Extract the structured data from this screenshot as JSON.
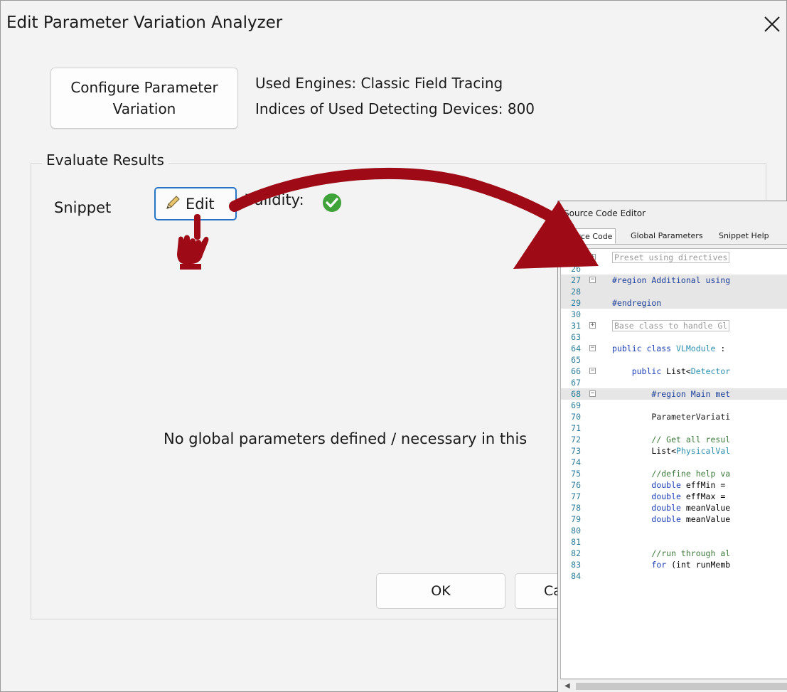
{
  "dialog": {
    "title": "Edit Parameter Variation Analyzer",
    "configure_button": "Configure Parameter Variation",
    "used_engines": "Used Engines: Classic Field Tracing",
    "detecting_devices": "Indices of Used Detecting Devices: 800",
    "group_title": "Evaluate Results",
    "snippet_label": "Snippet",
    "edit_button": "Edit",
    "validity_label": "Validity:",
    "no_params_message": "No global parameters defined / necessary in this",
    "ok_button": "OK",
    "cancel_button": "Ca"
  },
  "editor": {
    "title": "Source Code Editor",
    "tabs": [
      "Source Code",
      "Global Parameters",
      "Snippet Help"
    ],
    "lines": [
      {
        "n": "1",
        "text": "Preset using directives",
        "style": "collapsed",
        "fold": "plus"
      },
      {
        "n": "26",
        "text": ""
      },
      {
        "n": "27",
        "text": "#region Additional using",
        "style": "region",
        "fold": "minus",
        "shade": true
      },
      {
        "n": "28",
        "text": "",
        "shade": true
      },
      {
        "n": "29",
        "text": "#endregion",
        "style": "region",
        "shade": true
      },
      {
        "n": "30",
        "text": ""
      },
      {
        "n": "31",
        "text": "Base class to handle Gl",
        "style": "collapsed",
        "fold": "plus"
      },
      {
        "n": "63",
        "text": ""
      },
      {
        "n": "64",
        "text": "public class VLModule :",
        "style": "class",
        "fold": "minus"
      },
      {
        "n": "65",
        "text": ""
      },
      {
        "n": "66",
        "text": "    public List<Detector",
        "style": "list",
        "fold": "minus"
      },
      {
        "n": "67",
        "text": ""
      },
      {
        "n": "68",
        "text": "        #region Main met",
        "style": "region",
        "fold": "minus",
        "shade": true
      },
      {
        "n": "69",
        "text": ""
      },
      {
        "n": "70",
        "text": "        ParameterVariati",
        "style": "plain"
      },
      {
        "n": "71",
        "text": ""
      },
      {
        "n": "72",
        "text": "        // Get all resul",
        "style": "comment"
      },
      {
        "n": "73",
        "text": "        List<PhysicalVal",
        "style": "list2"
      },
      {
        "n": "74",
        "text": ""
      },
      {
        "n": "75",
        "text": "        //define help va",
        "style": "comment"
      },
      {
        "n": "76",
        "text": "        double effMin =",
        "style": "plain"
      },
      {
        "n": "77",
        "text": "        double effMax =",
        "style": "plain"
      },
      {
        "n": "78",
        "text": "        double meanValue",
        "style": "plain"
      },
      {
        "n": "79",
        "text": "        double meanValue",
        "style": "plain"
      },
      {
        "n": "80",
        "text": ""
      },
      {
        "n": "81",
        "text": ""
      },
      {
        "n": "82",
        "text": "        //run through al",
        "style": "comment"
      },
      {
        "n": "83",
        "text": "        for (int runMemb",
        "style": "plain"
      },
      {
        "n": "84",
        "text": ""
      }
    ]
  },
  "colors": {
    "arrow": "#9e0a16",
    "accent_border": "#2a74c4",
    "valid_green": "#3fa33a"
  },
  "icons": [
    "close-icon",
    "pencil-icon",
    "check-circle-icon",
    "pointing-hand-icon",
    "curved-arrow-icon"
  ]
}
